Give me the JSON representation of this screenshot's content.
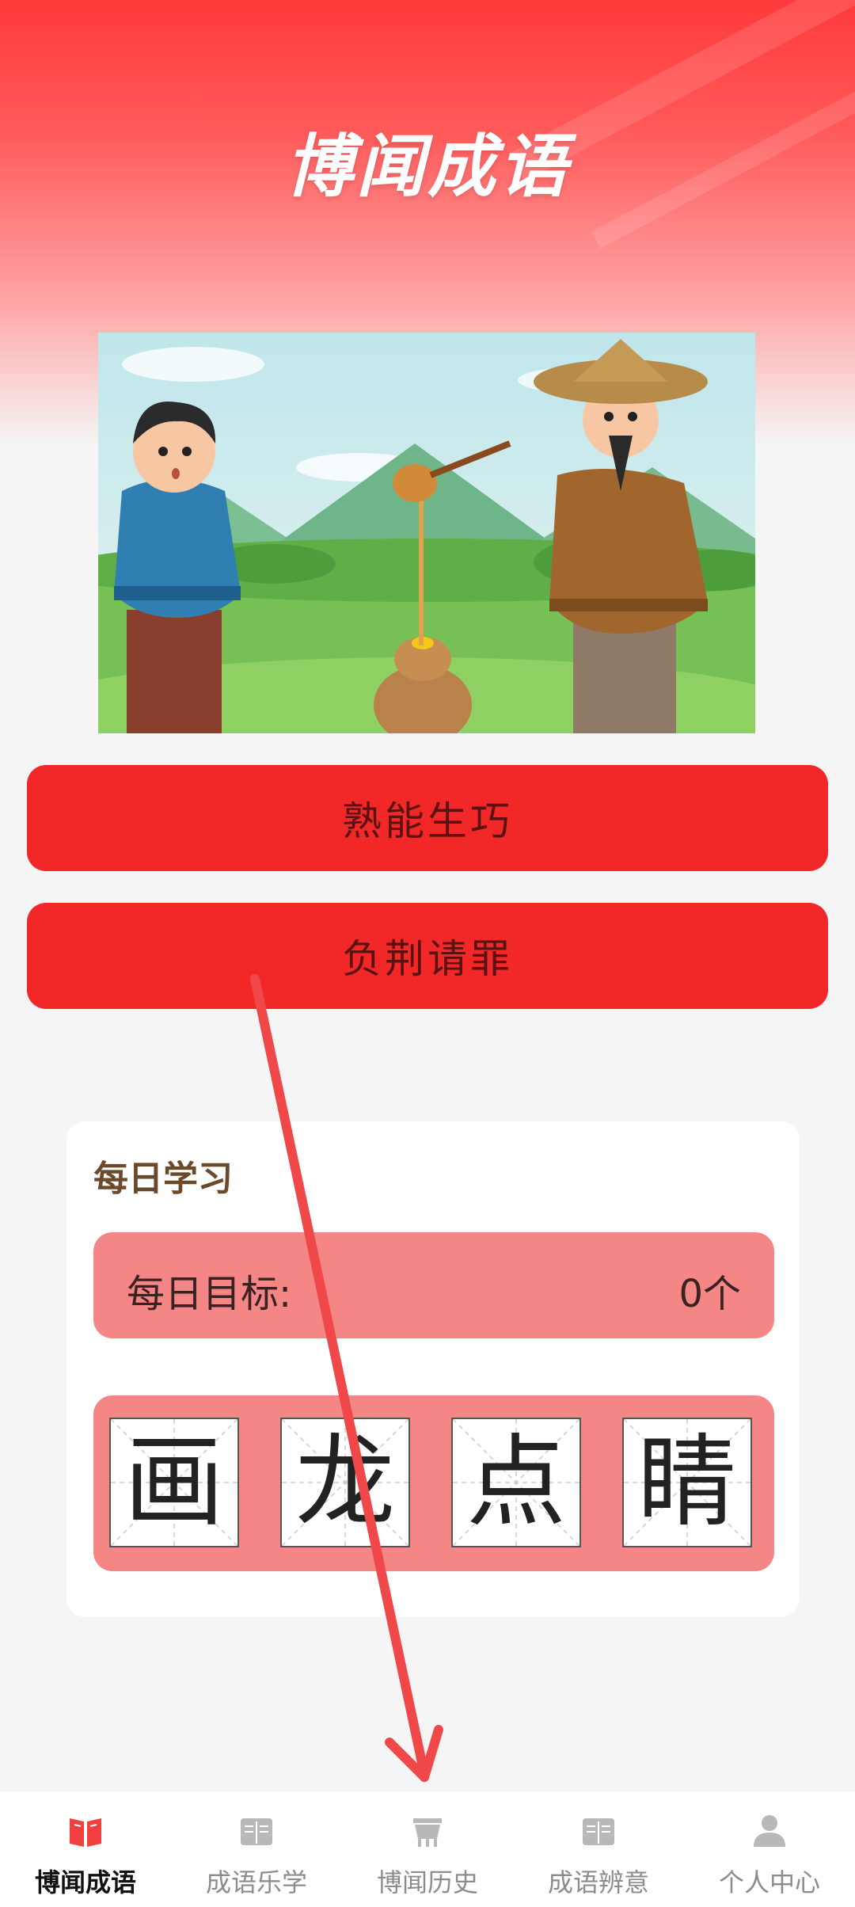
{
  "app": {
    "title": "博闻成语"
  },
  "idioms": [
    {
      "label": "熟能生巧"
    },
    {
      "label": "负荆请罪"
    }
  ],
  "daily": {
    "title": "每日学习",
    "goal_label": "每日目标:",
    "goal_value": "0个",
    "characters": [
      "画",
      "龙",
      "点",
      "睛"
    ]
  },
  "tabs": [
    {
      "label": "博闻成语",
      "icon": "book-open-icon",
      "active": true
    },
    {
      "label": "成语乐学",
      "icon": "book-icon",
      "active": false
    },
    {
      "label": "博闻历史",
      "icon": "ding-vessel-icon",
      "active": false
    },
    {
      "label": "成语辨意",
      "icon": "book-icon",
      "active": false
    },
    {
      "label": "个人中心",
      "icon": "user-icon",
      "active": false
    }
  ],
  "colors": {
    "accent": "#f22828",
    "tab_active_icon": "#f24040",
    "tab_inactive_icon": "#b8b8b8",
    "card_tint": "#f58686",
    "annotation_arrow": "#f04848"
  }
}
